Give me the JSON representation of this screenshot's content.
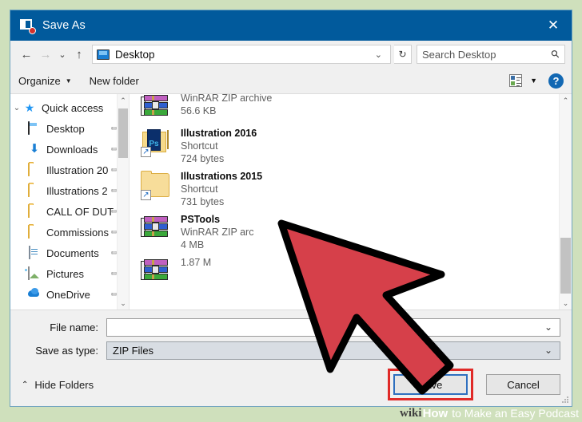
{
  "window": {
    "title": "Save As",
    "icon": "save-as-icon",
    "close_label": "✕"
  },
  "navbar": {
    "back_icon": "←",
    "forward_icon": "→",
    "recent_icon": "⌄",
    "up_icon": "↑",
    "address": {
      "icon": "desktop-icon",
      "value": "Desktop",
      "chevron": "⌄"
    },
    "refresh_icon": "↻",
    "search": {
      "placeholder": "Search Desktop",
      "icon": "⚲"
    }
  },
  "commandbar": {
    "organize_label": "Organize",
    "organize_caret": "▼",
    "new_folder_label": "New folder",
    "view_caret": "▼",
    "help_label": "?"
  },
  "sidebar": {
    "items": [
      {
        "label": "Quick access",
        "icon": "star-icon",
        "chevron": "⌄",
        "pinned": false,
        "indent": 0
      },
      {
        "label": "Desktop",
        "icon": "desktop-icon",
        "chevron": "",
        "pinned": true,
        "indent": 1
      },
      {
        "label": "Downloads",
        "icon": "download-icon",
        "chevron": "",
        "pinned": true,
        "indent": 1
      },
      {
        "label": "Illustration 20",
        "icon": "folder-icon",
        "chevron": "",
        "pinned": true,
        "indent": 1
      },
      {
        "label": "Illustrations 2",
        "icon": "folder-icon",
        "chevron": "",
        "pinned": true,
        "indent": 1
      },
      {
        "label": "CALL OF DUT",
        "icon": "folder-icon",
        "chevron": "",
        "pinned": true,
        "indent": 1
      },
      {
        "label": "Commissions",
        "icon": "folder-icon",
        "chevron": "",
        "pinned": true,
        "indent": 1
      },
      {
        "label": "Documents",
        "icon": "document-icon",
        "chevron": "",
        "pinned": true,
        "indent": 1
      },
      {
        "label": "Pictures",
        "icon": "picture-icon",
        "chevron": "",
        "pinned": true,
        "indent": 1
      },
      {
        "label": "OneDrive",
        "icon": "cloud-icon",
        "chevron": "",
        "pinned": true,
        "indent": 1
      }
    ],
    "pin_glyph": "✐",
    "scroll_up": "⌃",
    "scroll_down": "⌄"
  },
  "filelist": {
    "items": [
      {
        "name": "",
        "type": "WinRAR ZIP archive",
        "size": "56.6 KB",
        "icon": "winrar-zip-icon",
        "shortcut": false
      },
      {
        "name": "Illustration 2016",
        "type": "Shortcut",
        "size": "724 bytes",
        "icon": "photoshop-shortcut-icon",
        "shortcut": true
      },
      {
        "name": "Illustrations 2015",
        "type": "Shortcut",
        "size": "731 bytes",
        "icon": "folder-shortcut-icon",
        "shortcut": true
      },
      {
        "name": "PSTools",
        "type": "WinRAR ZIP arc",
        "size": "4 MB",
        "icon": "winrar-zip-icon",
        "shortcut": false
      },
      {
        "name": "",
        "type": "",
        "size": "1.87 M",
        "icon": "winrar-zip-icon",
        "shortcut": false
      }
    ],
    "scroll_up": "⌃",
    "scroll_down": "⌄"
  },
  "form": {
    "file_name_label": "File name:",
    "file_name_value": "",
    "file_name_caret": "⌄",
    "save_as_type_label": "Save as type:",
    "save_as_type_value": "ZIP Files",
    "save_as_type_caret": "⌄"
  },
  "footer": {
    "hide_folders_label": "Hide Folders",
    "hide_folders_caret": "⌃",
    "save_label": "Save",
    "cancel_label": "Cancel"
  },
  "watermark": {
    "wiki": "wiki",
    "how": "How",
    "rest": "to Make an Easy Podcast"
  },
  "colors": {
    "titlebar": "#015a9c",
    "dialog_bg": "#f0f0f0",
    "page_bg": "#cfe0bc",
    "accent_blue": "#1a7fd4",
    "arrow_red": "#d6404a",
    "highlight_red": "#e02a28",
    "focus_blue": "#2f6fbf"
  }
}
